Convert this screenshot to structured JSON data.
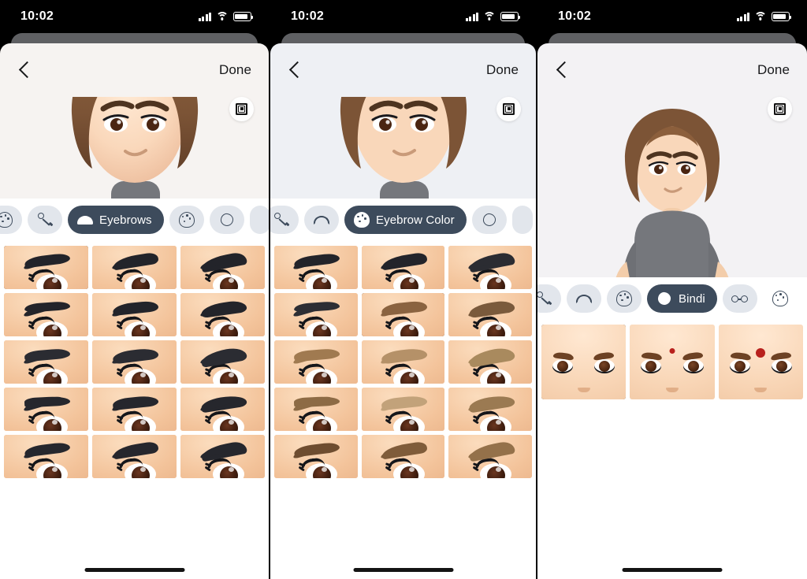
{
  "status_bar": {
    "time": "10:02",
    "signal_icon": "cellular-signal-icon",
    "wifi_icon": "wifi-icon",
    "battery_icon": "battery-icon"
  },
  "nav": {
    "back_icon": "back-chevron-icon",
    "done_label": "Done",
    "frame_button_icon": "picture-frame-icon"
  },
  "panels": [
    {
      "id": "eyebrows",
      "avatar": "memoji-head-curly-brown-hair",
      "categories": [
        {
          "icon": "palette-icon",
          "label": "",
          "active": false
        },
        {
          "icon": "eyeliner-icon",
          "label": "",
          "active": false
        },
        {
          "icon": "eyebrow-icon",
          "label": "Eyebrows",
          "active": true
        },
        {
          "icon": "palette-icon",
          "label": "",
          "active": false
        },
        {
          "icon": "bindi-icon",
          "label": "",
          "active": false
        }
      ],
      "grid_kind": "brows",
      "selected_index": 0,
      "options": [
        {
          "name": "eyebrow-style-1",
          "shape": "sA",
          "color": "#23242a"
        },
        {
          "name": "eyebrow-style-2",
          "shape": "sB",
          "color": "#23242a"
        },
        {
          "name": "eyebrow-style-3",
          "shape": "sC",
          "color": "#23242a"
        },
        {
          "name": "eyebrow-style-4",
          "shape": "sD",
          "color": "#23242a"
        },
        {
          "name": "eyebrow-style-5",
          "shape": "sE",
          "color": "#23242a"
        },
        {
          "name": "eyebrow-style-6",
          "shape": "sF",
          "color": "#23242a"
        },
        {
          "name": "eyebrow-style-7",
          "shape": "sG",
          "color": "#2b2c32"
        },
        {
          "name": "eyebrow-style-8",
          "shape": "sH",
          "color": "#2b2c32"
        },
        {
          "name": "eyebrow-style-9",
          "shape": "sI",
          "color": "#2b2c32"
        },
        {
          "name": "eyebrow-style-10",
          "shape": "sJ",
          "color": "#26272d"
        },
        {
          "name": "eyebrow-style-11",
          "shape": "sK",
          "color": "#26272d"
        },
        {
          "name": "eyebrow-style-12",
          "shape": "sL",
          "color": "#26272d"
        },
        {
          "name": "eyebrow-style-13",
          "shape": "sA",
          "color": "#26272d"
        },
        {
          "name": "eyebrow-style-14",
          "shape": "sB",
          "color": "#26272d"
        },
        {
          "name": "eyebrow-style-15",
          "shape": "sC",
          "color": "#26272d"
        }
      ]
    },
    {
      "id": "eyebrow-color",
      "avatar": "memoji-head-curly-brown-hair",
      "categories": [
        {
          "icon": "eyeliner-icon",
          "label": "",
          "active": false
        },
        {
          "icon": "eyebrow-icon",
          "label": "",
          "active": false
        },
        {
          "icon": "palette-icon",
          "label": "Eyebrow Color",
          "active": true
        },
        {
          "icon": "bindi-icon",
          "label": "",
          "active": false
        }
      ],
      "grid_kind": "brows",
      "selected_index": 4,
      "options": [
        {
          "name": "eyebrow-color-1",
          "shape": "sA",
          "color": "#23242a"
        },
        {
          "name": "eyebrow-color-2",
          "shape": "sB",
          "color": "#23242a"
        },
        {
          "name": "eyebrow-color-3",
          "shape": "sC",
          "color": "#2b2c32"
        },
        {
          "name": "eyebrow-color-4",
          "shape": "sD",
          "color": "#2d2e34"
        },
        {
          "name": "eyebrow-color-5",
          "shape": "sE",
          "color": "#8a6340"
        },
        {
          "name": "eyebrow-color-6",
          "shape": "sF",
          "color": "#7a5a3c"
        },
        {
          "name": "eyebrow-color-7",
          "shape": "sG",
          "color": "#a07a50"
        },
        {
          "name": "eyebrow-color-8",
          "shape": "sH",
          "color": "#b59168"
        },
        {
          "name": "eyebrow-color-9",
          "shape": "sI",
          "color": "#a98a5e"
        },
        {
          "name": "eyebrow-color-10",
          "shape": "sJ",
          "color": "#8d6b45"
        },
        {
          "name": "eyebrow-color-11",
          "shape": "sK",
          "color": "#c2a27a"
        },
        {
          "name": "eyebrow-color-12",
          "shape": "sL",
          "color": "#9b7a52"
        },
        {
          "name": "eyebrow-color-13",
          "shape": "sA",
          "color": "#6e4d30"
        },
        {
          "name": "eyebrow-color-14",
          "shape": "sB",
          "color": "#7f5c3a"
        },
        {
          "name": "eyebrow-color-15",
          "shape": "sC",
          "color": "#94714a"
        }
      ]
    },
    {
      "id": "bindi",
      "avatar": "memoji-body-grey-tshirt",
      "categories": [
        {
          "icon": "eyeliner-icon",
          "label": "",
          "active": false
        },
        {
          "icon": "eyebrow-icon",
          "label": "",
          "active": false
        },
        {
          "icon": "palette-icon",
          "label": "",
          "active": false
        },
        {
          "icon": "bindi-icon",
          "label": "Bindi",
          "active": true
        },
        {
          "icon": "glasses-icon",
          "label": "",
          "active": false
        },
        {
          "icon": "palette-icon",
          "label": "",
          "active": false
        }
      ],
      "grid_kind": "bindi",
      "selected_index": 0,
      "options": [
        {
          "name": "bindi-none",
          "dot": "none"
        },
        {
          "name": "bindi-small-red",
          "dot": "sm"
        },
        {
          "name": "bindi-large-red",
          "dot": "lg"
        }
      ]
    }
  ],
  "colors": {
    "accent_active_pill": "#3d4b5c",
    "pill_inactive": "#e2e6ec",
    "selection_outline": "#17181a",
    "bindi_red": "#b8211d",
    "shirt_grey": "#75777c",
    "hair_brown": "#7c5436"
  }
}
